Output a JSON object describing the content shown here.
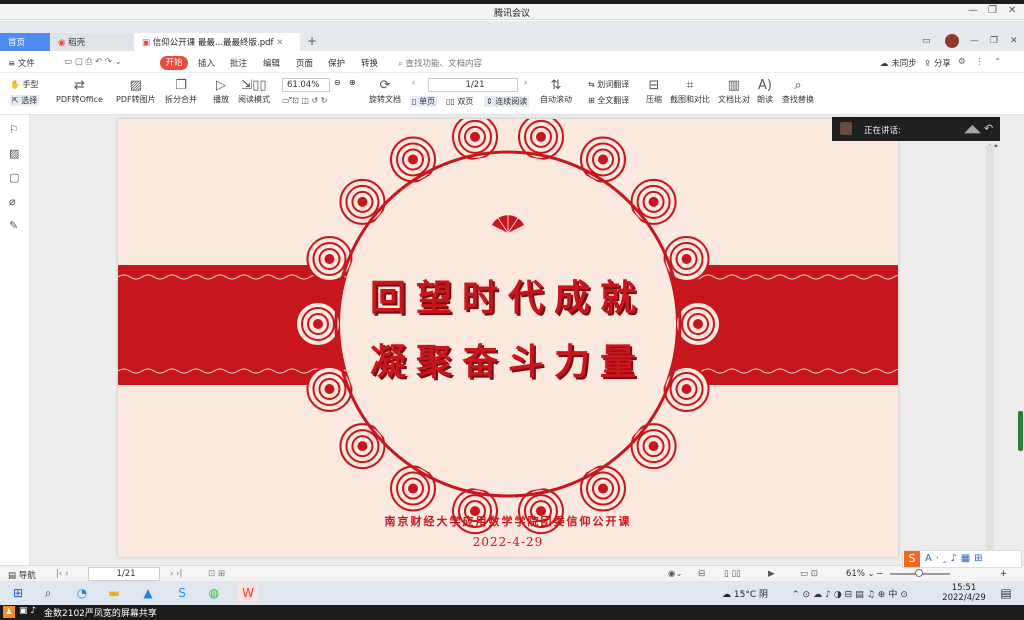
{
  "meeting": {
    "title": "腾讯会议",
    "sharing_text": "金数2102严凤宽的屏幕共享"
  },
  "tabs": {
    "home": "首页",
    "docer": "稻壳",
    "pdf": "信仰公开课 最最...最最终版.pdf"
  },
  "menu": {
    "file": "文件",
    "start": "开始",
    "insert": "插入",
    "annotate": "批注",
    "edit": "编辑",
    "page": "页面",
    "protect": "保护",
    "convert": "转换",
    "search_placeholder": "查找功能、文档内容",
    "unsynced": "未同步",
    "share": "分享"
  },
  "toolbar": {
    "hand": "手型",
    "select": "选择",
    "pdf_to_office": "PDF转Office",
    "pdf_to_image": "PDF转图片",
    "split_merge": "拆分合并",
    "play": "播放",
    "read_mode": "阅读模式",
    "zoom": "61.04%",
    "rotate": "旋转文档",
    "single": "单页",
    "double": "双页",
    "continuous": "连续阅读",
    "page_indicator": "1/21",
    "auto_scroll": "自动滚动",
    "word_translate": "划词翻译",
    "full_translate": "全文翻译",
    "compress": "压缩",
    "screenshot_compare": "截图和对比",
    "doc_compare": "文档比对",
    "read_aloud": "朗读",
    "find_replace": "查找替换"
  },
  "speaker": {
    "label": "正在讲话:"
  },
  "slide": {
    "title_line1": "回望时代成就",
    "title_line2": "凝聚奋斗力量",
    "org": "南京财经大学应用数学学院团委信仰公开课",
    "date": "2022-4-29",
    "colors": {
      "red": "#c8161d",
      "bg": "#fbe8df"
    }
  },
  "status": {
    "nav": "导航",
    "page": "1/21",
    "zoom": "61%"
  },
  "taskbar": {
    "weather": "15°C 阴",
    "time": "15:51",
    "date": "2022/4/29"
  }
}
